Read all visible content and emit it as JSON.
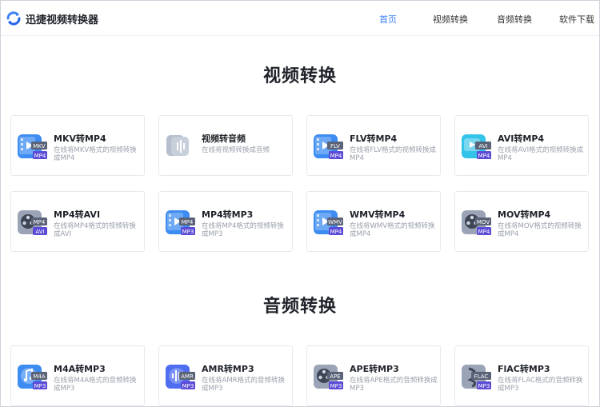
{
  "app": {
    "brand": "迅捷视频转换器"
  },
  "nav": [
    {
      "label": "首页",
      "active": true
    },
    {
      "label": "视频转换",
      "active": false
    },
    {
      "label": "音频转换",
      "active": false
    },
    {
      "label": "软件下载",
      "active": false
    }
  ],
  "video_section": {
    "title": "视频转换",
    "cards": [
      {
        "title": "MKV转MP4",
        "desc": "在线将MKV格式的视频转换成MP4",
        "icon": "film-icon",
        "badge_top": "MKV",
        "badge_bottom": "MP4"
      },
      {
        "title": "视频转音频",
        "desc": "在线将视频转换成音频",
        "icon": "audio-wave-icon",
        "badge_top": "",
        "badge_bottom": ""
      },
      {
        "title": "FLV转MP4",
        "desc": "在线将FLV格式的视频转换成MP4",
        "icon": "film-icon",
        "badge_top": "FLV",
        "badge_bottom": "MP4"
      },
      {
        "title": "AVI转MP4",
        "desc": "在线将AVI格式的视频转换成MP4",
        "icon": "play-icon",
        "badge_top": "AVI",
        "badge_bottom": "MP4"
      },
      {
        "title": "MP4转AVI",
        "desc": "在线将MP4格式的视频转换成AVI",
        "icon": "reel-icon",
        "badge_top": "MP4",
        "badge_bottom": "AVI"
      },
      {
        "title": "MP4转MP3",
        "desc": "在线将MP4格式的视频转换成MP3",
        "icon": "film-icon",
        "badge_top": "MP4",
        "badge_bottom": "MP3"
      },
      {
        "title": "WMV转MP4",
        "desc": "在线将WMV格式的视频转换成MP4",
        "icon": "film-icon",
        "badge_top": "WMV",
        "badge_bottom": "MP4"
      },
      {
        "title": "MOV转MP4",
        "desc": "在线将MOV格式的视频转换成MP4",
        "icon": "reel-icon",
        "badge_top": "MOV",
        "badge_bottom": "MP4"
      }
    ]
  },
  "audio_section": {
    "title": "音频转换",
    "cards": [
      {
        "title": "M4A转MP3",
        "desc": "在线将M4A格式的音频转换成MP3",
        "icon": "music-icon",
        "badge_top": "M4A",
        "badge_bottom": "MP3"
      },
      {
        "title": "AMR转MP3",
        "desc": "在线将AMR格式的音频转换成MP3",
        "icon": "wave-icon",
        "badge_top": "AMR",
        "badge_bottom": "MP3"
      },
      {
        "title": "APE转MP3",
        "desc": "在线将APE格式的音频转换成MP3",
        "icon": "reel-icon",
        "badge_top": "APE",
        "badge_bottom": "MP3"
      },
      {
        "title": "FlAC转MP3",
        "desc": "在线将FLAC格式的音频转换成MP3",
        "icon": "music-note-icon",
        "badge_top": "FLAC",
        "badge_bottom": "MP3"
      }
    ]
  },
  "colors": {
    "accent": "#3b82f6",
    "blue_icon": "#3d8cf2",
    "cyan_icon": "#33c2e8",
    "gray_icon": "#9aa4b6",
    "badge_purple": "#5b4bd6",
    "badge_dark": "#5a6377"
  }
}
